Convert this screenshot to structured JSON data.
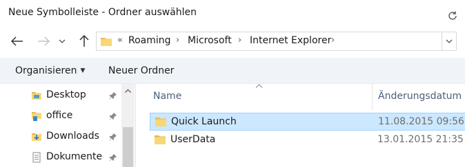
{
  "window": {
    "title": "Neue Symbolleiste - Ordner auswählen"
  },
  "address_bar": {
    "overflow_glyph": "«",
    "breadcrumbs": [
      "Roaming",
      "Microsoft",
      "Internet Explorer"
    ],
    "separator": "›"
  },
  "toolbar": {
    "organize_label": "Organisieren",
    "new_folder_label": "Neuer Ordner"
  },
  "sidebar": {
    "items": [
      {
        "label": "Desktop",
        "icon": "desktop-folder-icon"
      },
      {
        "label": "office",
        "icon": "network-folder-icon"
      },
      {
        "label": "Downloads",
        "icon": "downloads-folder-icon"
      },
      {
        "label": "Dokumente",
        "icon": "documents-folder-icon"
      }
    ]
  },
  "file_list": {
    "columns": {
      "name": "Name",
      "modified": "Änderungsdatum"
    },
    "rows": [
      {
        "name": "Quick Launch",
        "modified": "11.08.2015 09:56",
        "selected": true
      },
      {
        "name": "UserData",
        "modified": "13.01.2015 21:35",
        "selected": false
      }
    ]
  },
  "colors": {
    "selection_bg": "#cce8ff",
    "selection_border": "#99d1ff",
    "command_bar_bg": "#f0f4f9",
    "folder_yellow": "#f8d775",
    "column_header_text": "#4c607a"
  }
}
